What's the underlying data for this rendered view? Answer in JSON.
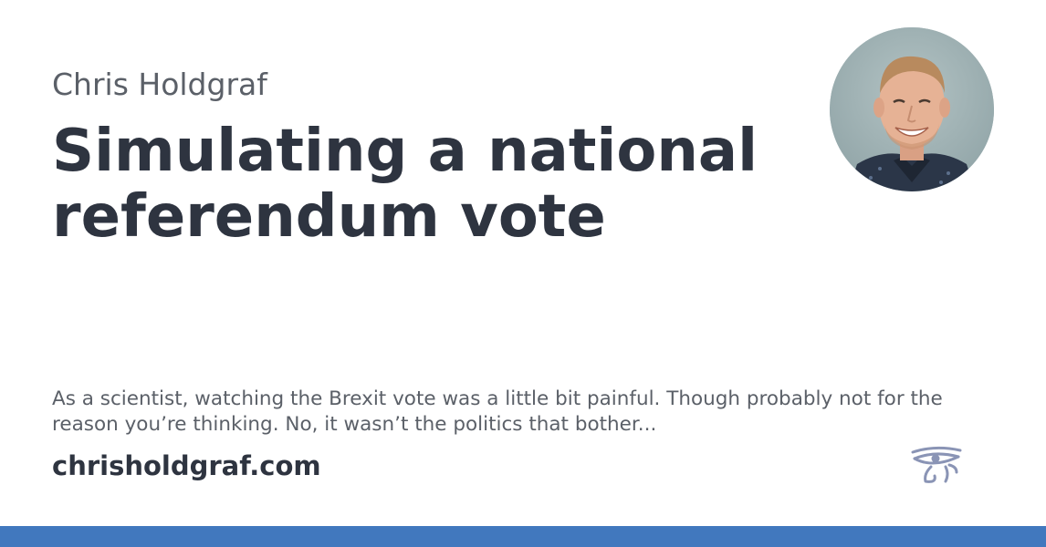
{
  "author": "Chris Holdgraf",
  "title": "Simulating a national referendum vote",
  "excerpt": "As a scientist, watching the Brexit vote was a little bit painful. Though probably not for the reason you’re thinking. No, it wasn’t the politics that bother...",
  "domain": "chrisholdgraf.com",
  "icons": {
    "avatar": "author-portrait",
    "logo": "eye-of-horus-icon"
  },
  "colors": {
    "accent_bar": "#4178be",
    "title_text": "#2e3440",
    "muted_text": "#5b6068",
    "logo": "#8a94b5"
  }
}
